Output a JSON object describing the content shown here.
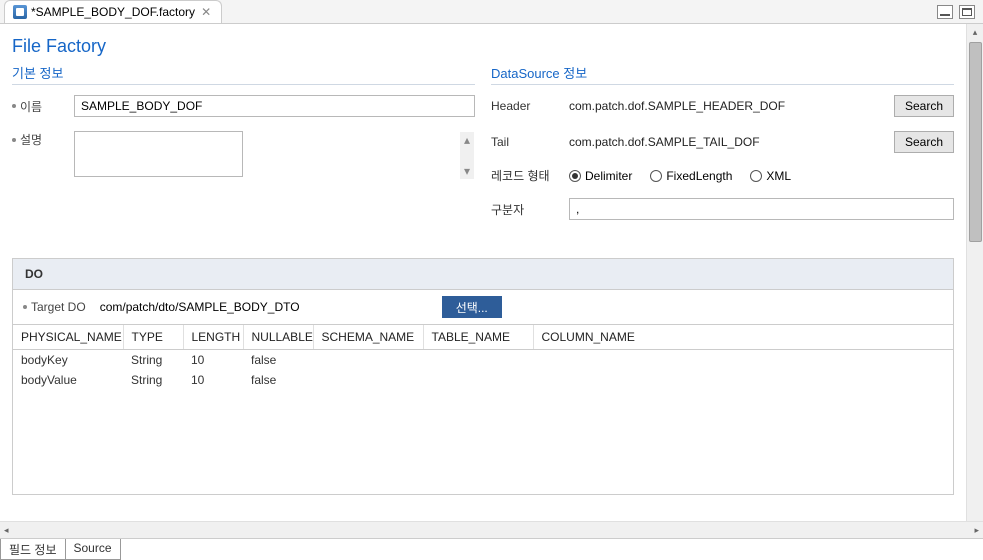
{
  "tab": {
    "title": "*SAMPLE_BODY_DOF.factory",
    "close_glyph": "✕"
  },
  "page_title": "File Factory",
  "basic": {
    "section_title": "기본 정보",
    "name_label": "이름",
    "name_value": "SAMPLE_BODY_DOF",
    "desc_label": "설명",
    "desc_value": ""
  },
  "ds": {
    "section_title": "DataSource 정보",
    "header_label": "Header",
    "header_value": "com.patch.dof.SAMPLE_HEADER_DOF",
    "tail_label": "Tail",
    "tail_value": "com.patch.dof.SAMPLE_TAIL_DOF",
    "search_label": "Search",
    "record_label": "레코드 형태",
    "opt_delimiter": "Delimiter",
    "opt_fixed": "FixedLength",
    "opt_xml": "XML",
    "delim_label": "구분자",
    "delim_value": ","
  },
  "do_panel": {
    "title": "DO",
    "target_label": "Target DO",
    "target_value": "com/patch/dto/SAMPLE_BODY_DTO",
    "select_label": "선택...",
    "columns": {
      "physical": "PHYSICAL_NAME",
      "type": "TYPE",
      "length": "LENGTH",
      "nullable": "NULLABLE",
      "schema": "SCHEMA_NAME",
      "table": "TABLE_NAME",
      "column": "COLUMN_NAME"
    },
    "rows": [
      {
        "physical": "bodyKey",
        "type": "String",
        "length": "10",
        "nullable": "false"
      },
      {
        "physical": "bodyValue",
        "type": "String",
        "length": "10",
        "nullable": "false"
      }
    ]
  },
  "bottom_tabs": {
    "t1": "필드 정보",
    "t2": "Source"
  }
}
